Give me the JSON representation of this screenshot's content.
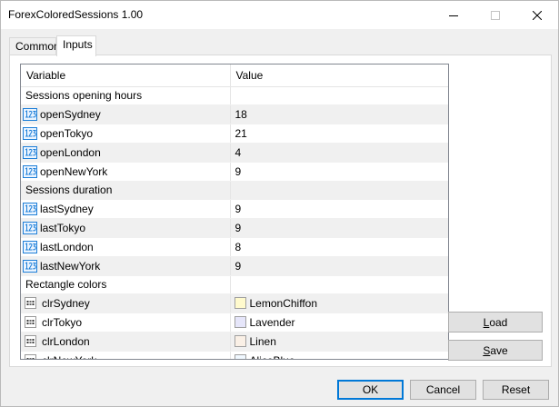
{
  "window": {
    "title": "ForexColoredSessions 1.00"
  },
  "tabs": [
    {
      "label": "Common"
    },
    {
      "label": "Inputs"
    }
  ],
  "grid": {
    "headers": {
      "variable": "Variable",
      "value": "Value"
    },
    "rows": [
      {
        "type": "group",
        "label": "Sessions opening hours"
      },
      {
        "type": "int",
        "name": "openSydney",
        "value": "18"
      },
      {
        "type": "int",
        "name": "openTokyo",
        "value": "21"
      },
      {
        "type": "int",
        "name": "openLondon",
        "value": "4"
      },
      {
        "type": "int",
        "name": "openNewYork",
        "value": "9"
      },
      {
        "type": "group",
        "label": "Sessions duration"
      },
      {
        "type": "int",
        "name": "lastSydney",
        "value": "9"
      },
      {
        "type": "int",
        "name": "lastTokyo",
        "value": "9"
      },
      {
        "type": "int",
        "name": "lastLondon",
        "value": "8"
      },
      {
        "type": "int",
        "name": "lastNewYork",
        "value": "9"
      },
      {
        "type": "group",
        "label": "Rectangle colors"
      },
      {
        "type": "color",
        "name": "clrSydney",
        "value": "LemonChiffon",
        "color": "#FFFACD"
      },
      {
        "type": "color",
        "name": "clrTokyo",
        "value": "Lavender",
        "color": "#E6E6FA"
      },
      {
        "type": "color",
        "name": "clrLondon",
        "value": "Linen",
        "color": "#FAF0E6"
      },
      {
        "type": "color",
        "name": "clrNewYork",
        "value": "AliceBlue",
        "color": "#F0F8FF"
      }
    ]
  },
  "side_buttons": {
    "load_letter": "L",
    "load_rest": "oad",
    "save_letter": "S",
    "save_rest": "ave"
  },
  "buttons": {
    "ok": "OK",
    "cancel": "Cancel",
    "reset": "Reset"
  },
  "colors": {
    "accent": "#0078d7",
    "int_icon": "#1e7fd8"
  }
}
